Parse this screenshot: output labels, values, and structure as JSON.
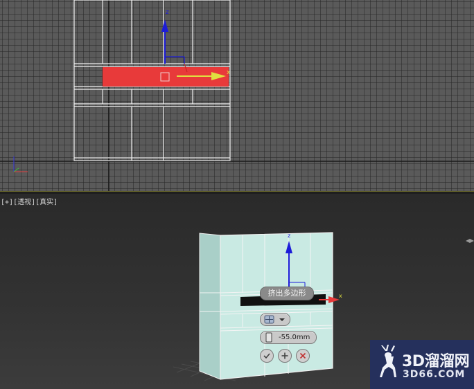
{
  "viewport_label": {
    "plus": "[+]",
    "view": "[透视]",
    "shading": "[真实]"
  },
  "gizmo": {
    "axis_z": "z",
    "axis_x": "x"
  },
  "caddy": {
    "operation_label": "挤出多边形",
    "extrusion_type_icon": "grid-icon",
    "extrusion_height": "-55.0mm",
    "ok_icon": "check-icon",
    "apply_icon": "plus-icon",
    "cancel_icon": "x-icon"
  },
  "watermark": {
    "title": "3D溜溜网",
    "subtitle": "3D66.COM",
    "logo_icon": "deer-icon"
  },
  "colors": {
    "selection_red": "#e83a3a",
    "wire_white": "#f0f0f0",
    "mesh_cyan": "#c9eae3",
    "axis_blue": "#1c1cd8",
    "axis_yellow": "#e0e040",
    "watermark_bg": "#25305c"
  }
}
